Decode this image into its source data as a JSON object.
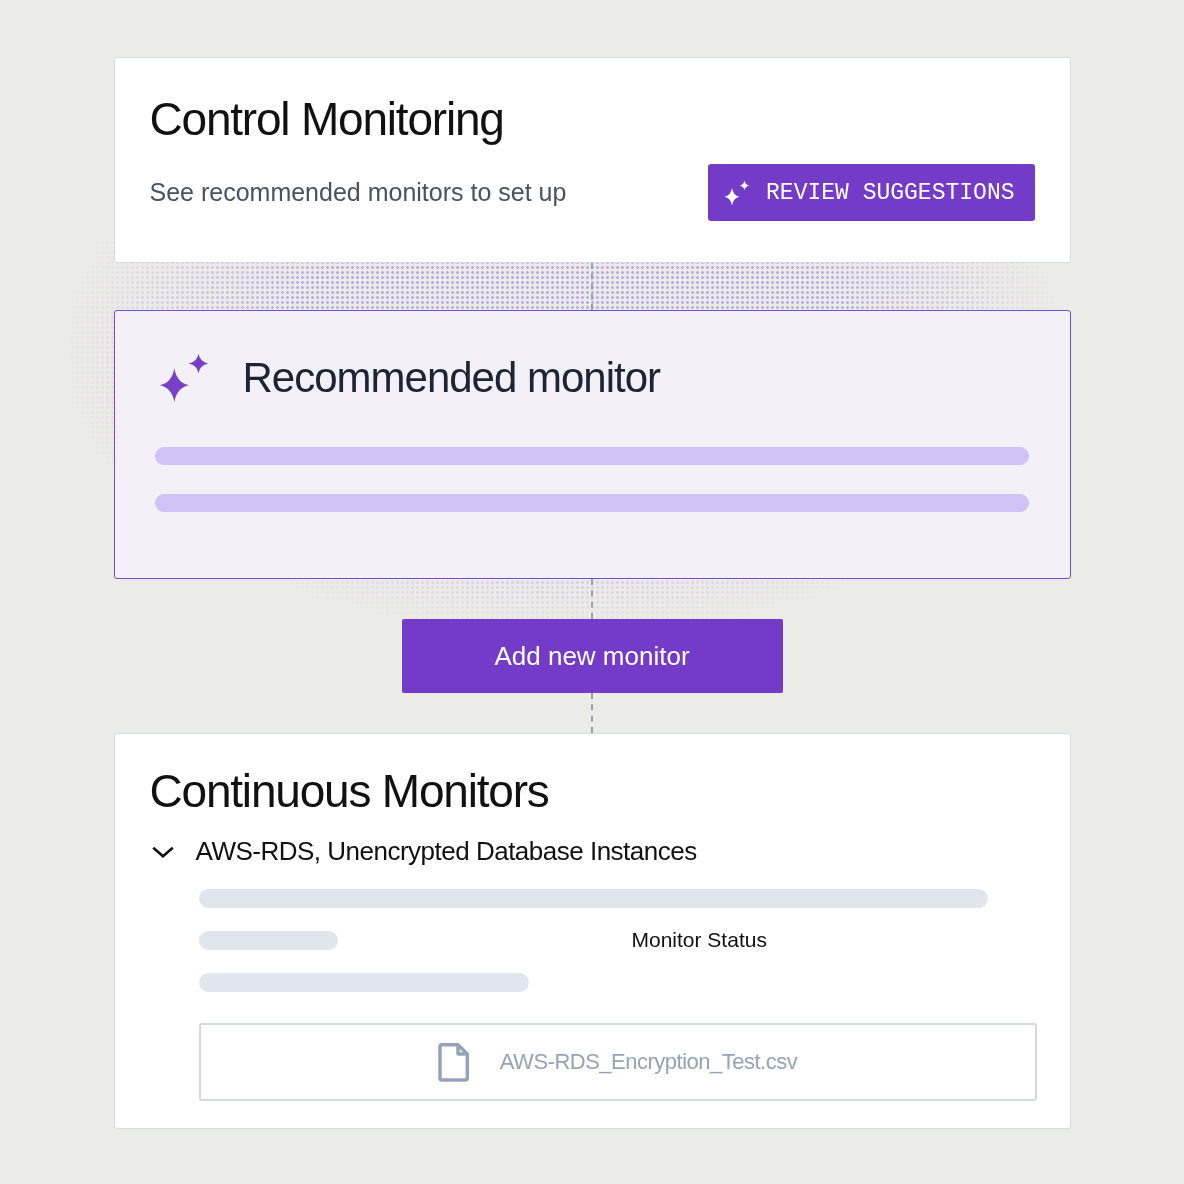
{
  "control_monitoring": {
    "title": "Control Monitoring",
    "subtitle": "See recommended monitors to set up",
    "button": "REVIEW SUGGESTIONS"
  },
  "recommended": {
    "title": "Recommended monitor"
  },
  "add_button": "Add new monitor",
  "continuous_monitors": {
    "title": "Continuous Monitors",
    "monitor": {
      "name": "AWS-RDS, Unencrypted Database Instances",
      "expanded": true,
      "status_label": "Monitor Status",
      "file": "AWS-RDS_Encryption_Test.csv"
    }
  }
}
